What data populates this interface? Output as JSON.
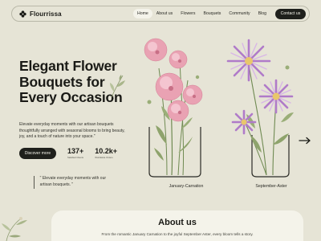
{
  "nav": {
    "brand": "Flourrissa",
    "items": [
      {
        "label": "Home",
        "active": true
      },
      {
        "label": "About us",
        "active": false
      },
      {
        "label": "Flowers",
        "active": false
      },
      {
        "label": "Bouquets",
        "active": false
      },
      {
        "label": "Community",
        "active": false
      },
      {
        "label": "Blog",
        "active": false
      }
    ],
    "contact_label": "Contact us"
  },
  "hero": {
    "title_line1": "Elegant Flower",
    "title_line2": "Bouquets for",
    "title_line3": "Every Occasion",
    "description": "Elevate everyday moments with our artisan bouquets thoughtfully arranged with seasonal blooms to bring beauty, joy, and a touch of nature into your space.\"",
    "cta_label": "Discover more",
    "stats": [
      {
        "value": "137+",
        "label": "Satisfied Clients"
      },
      {
        "value": "10.2k+",
        "label": "Worldwide Orders"
      }
    ],
    "quote": "\" Elevate everyday moments with our artisan bouquets. \""
  },
  "flowers": [
    {
      "caption": "January-Carnation",
      "icon": "carnation-illustration"
    },
    {
      "caption": "September-Aster",
      "icon": "aster-illustration"
    }
  ],
  "about": {
    "title": "About us",
    "text": "From the romantic January Carnation to the joyful September Aster, every bloom tells a story."
  },
  "colors": {
    "background": "#e6e4d6",
    "dark": "#1f201c",
    "panel": "#f4f3ea",
    "carnation": "#e9a2b3",
    "aster": "#c9a1dc"
  }
}
